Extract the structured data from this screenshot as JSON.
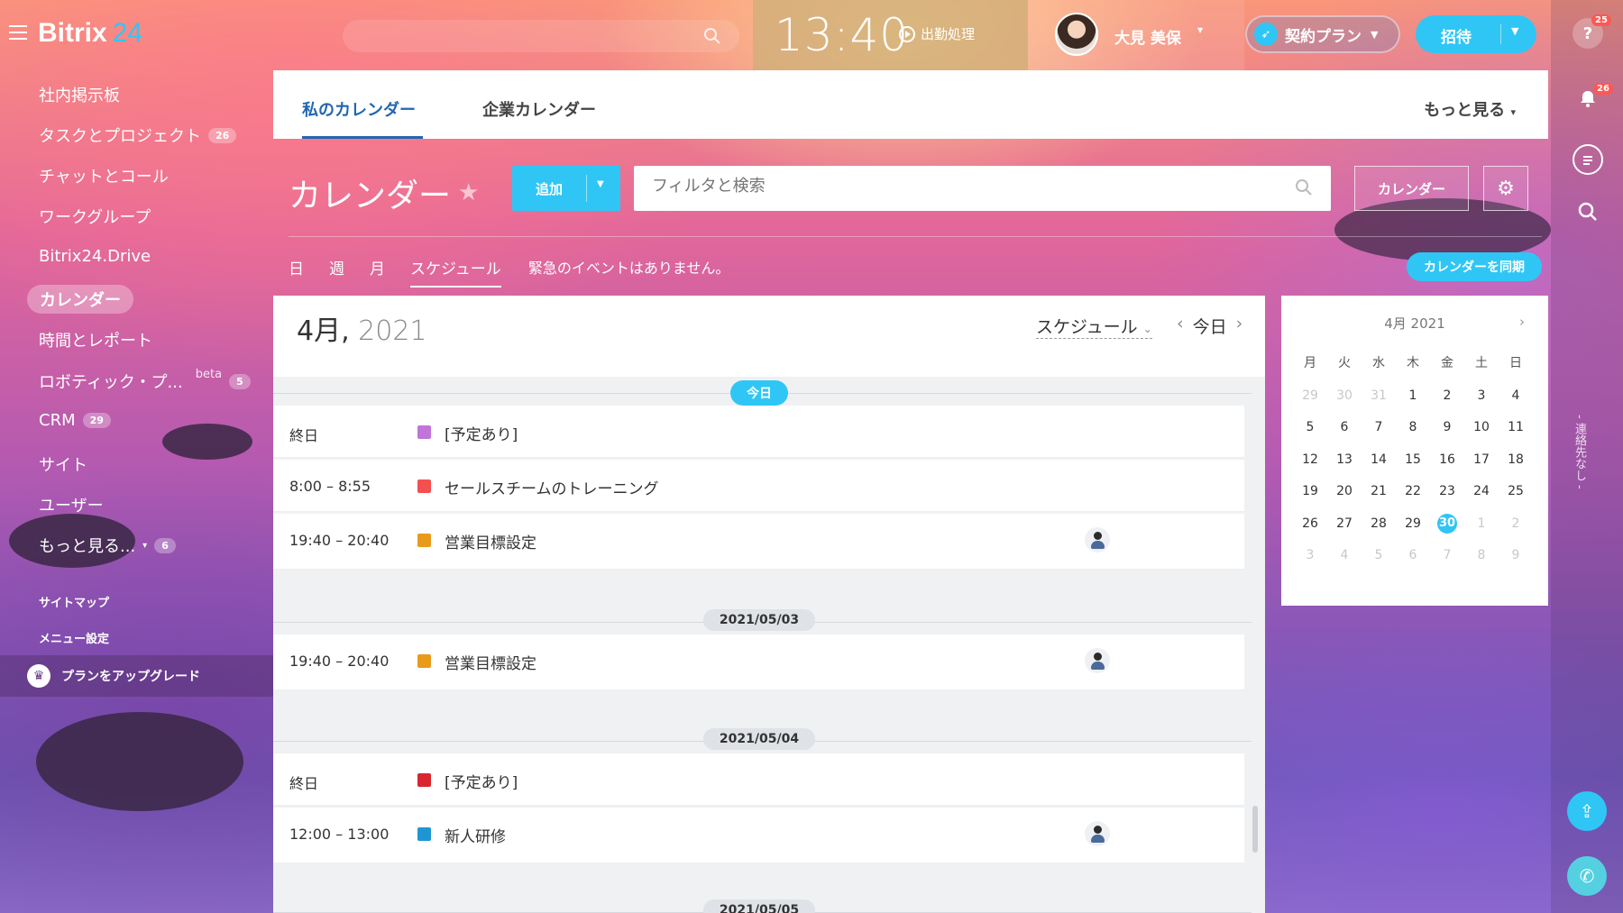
{
  "header": {
    "logo_text": "Bitrix",
    "logo_num": "24",
    "clock": "13:40",
    "work_label": "出勤処理",
    "user_name": "大見 美保",
    "plan_label": "契約プラン",
    "invite_label": "招待"
  },
  "rail": {
    "help_badge": "25",
    "notify_badge": "26",
    "vertical_text": "- 連絡先なし -"
  },
  "sidebar": {
    "items": [
      {
        "label": "社内掲示板",
        "badge": ""
      },
      {
        "label": "タスクとプロジェクト",
        "badge": "26"
      },
      {
        "label": "チャットとコール",
        "badge": ""
      },
      {
        "label": "ワークグループ",
        "badge": ""
      },
      {
        "label": "Bitrix24.Drive",
        "badge": ""
      },
      {
        "label": "カレンダー",
        "badge": ""
      },
      {
        "label": "時間とレポート",
        "badge": ""
      },
      {
        "label": "ロボティック・プ...",
        "badge": "5",
        "extra": "beta"
      },
      {
        "label": "CRM",
        "badge": "29"
      },
      {
        "label": "サイト",
        "badge": ""
      },
      {
        "label": "ユーザー",
        "badge": ""
      },
      {
        "label": "もっと見る...",
        "badge": "6"
      }
    ],
    "sitemap": "サイトマップ",
    "menu_settings": "メニュー設定",
    "upgrade": "プランをアップグレード"
  },
  "tabs": {
    "my_calendar": "私のカレンダー",
    "company_calendar": "企業カレンダー",
    "more": "もっと見る"
  },
  "toolbar": {
    "title": "カレンダー",
    "add_label": "追加",
    "search_placeholder": "フィルタと検索",
    "calendars_label": "カレンダー",
    "sync_label": "カレンダーを同期"
  },
  "views": {
    "day": "日",
    "week": "週",
    "month": "月",
    "schedule": "スケジュール",
    "no_events": "緊急のイベントはありません。"
  },
  "schedule": {
    "month": "4月,",
    "year": "2021",
    "view_select": "スケジュール",
    "today_label": "今日",
    "groups": [
      {
        "label": "今日",
        "events": [
          {
            "time": "終日",
            "title": "[予定あり]",
            "color": "#c175d8",
            "attendee": false
          },
          {
            "time": "8:00 – 8:55",
            "title": "セールスチームのトレーニング",
            "color": "#f4504f",
            "attendee": false
          },
          {
            "time": "19:40 – 20:40",
            "title": "営業目標設定",
            "color": "#e89b1a",
            "attendee": true
          }
        ]
      },
      {
        "label": "2021/05/03",
        "events": [
          {
            "time": "19:40 – 20:40",
            "title": "営業目標設定",
            "color": "#e89b1a",
            "attendee": true
          }
        ]
      },
      {
        "label": "2021/05/04",
        "events": [
          {
            "time": "終日",
            "title": "[予定あり]",
            "color": "#d9252e",
            "attendee": false
          },
          {
            "time": "12:00 – 13:00",
            "title": "新人研修",
            "color": "#1e96d4",
            "attendee": true
          }
        ]
      },
      {
        "label": "2021/05/05",
        "events": []
      }
    ]
  },
  "mini_calendar": {
    "title": "4月 2021",
    "weekdays": [
      "月",
      "火",
      "水",
      "木",
      "金",
      "土",
      "日"
    ],
    "weeks": [
      [
        "29",
        "30",
        "31",
        "1",
        "2",
        "3",
        "4"
      ],
      [
        "5",
        "6",
        "7",
        "8",
        "9",
        "10",
        "11"
      ],
      [
        "12",
        "13",
        "14",
        "15",
        "16",
        "17",
        "18"
      ],
      [
        "19",
        "20",
        "21",
        "22",
        "23",
        "24",
        "25"
      ],
      [
        "26",
        "27",
        "28",
        "29",
        "30",
        "1",
        "2"
      ],
      [
        "3",
        "4",
        "5",
        "6",
        "7",
        "8",
        "9"
      ]
    ],
    "selected": "30"
  }
}
